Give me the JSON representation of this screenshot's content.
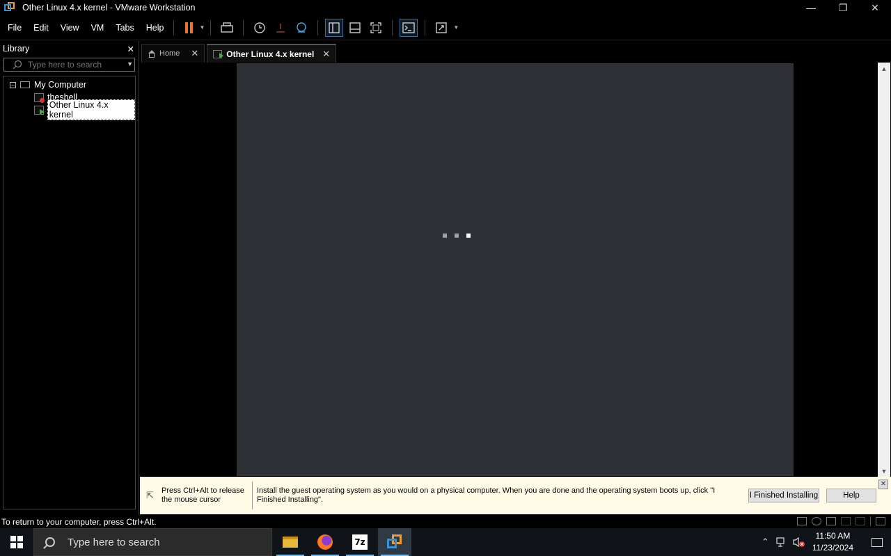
{
  "window": {
    "title": "Other Linux 4.x kernel - VMware Workstation",
    "minimize": "—",
    "restore": "❐",
    "close": "✕"
  },
  "menu": {
    "items": [
      "File",
      "Edit",
      "View",
      "VM",
      "Tabs",
      "Help"
    ]
  },
  "library": {
    "title": "Library",
    "close": "✕",
    "search_placeholder": "Type here to search",
    "tree": {
      "root": "My Computer",
      "items": [
        {
          "label": "theshell",
          "state": "stopped"
        },
        {
          "label": "Other Linux 4.x kernel",
          "state": "running",
          "selected": true
        }
      ]
    }
  },
  "tabs": [
    {
      "label": "Home",
      "close": "✕"
    },
    {
      "label": "Other Linux 4.x kernel",
      "close": "✕",
      "active": true
    }
  ],
  "hint": {
    "release": "Press Ctrl+Alt to release the mouse cursor",
    "message": "Install the guest operating system as you would on a physical computer. When you are done and the operating system boots up, click \"I Finished Installing\".",
    "finished_button": "I Finished Installing",
    "help_button": "Help",
    "close": "✕"
  },
  "status": {
    "text": "To return to your computer, press Ctrl+Alt."
  },
  "taskbar": {
    "search_placeholder": "Type here to search",
    "apps": [
      "file-explorer",
      "firefox",
      "7-zip",
      "vmware-workstation"
    ],
    "sevenzip_label": "7z",
    "time": "11:50 AM",
    "date": "11/23/2024"
  },
  "colors": {
    "pause_accent": "#e8742a",
    "vm_screen": "#2d3135",
    "hint_background": "#fffbe6"
  }
}
